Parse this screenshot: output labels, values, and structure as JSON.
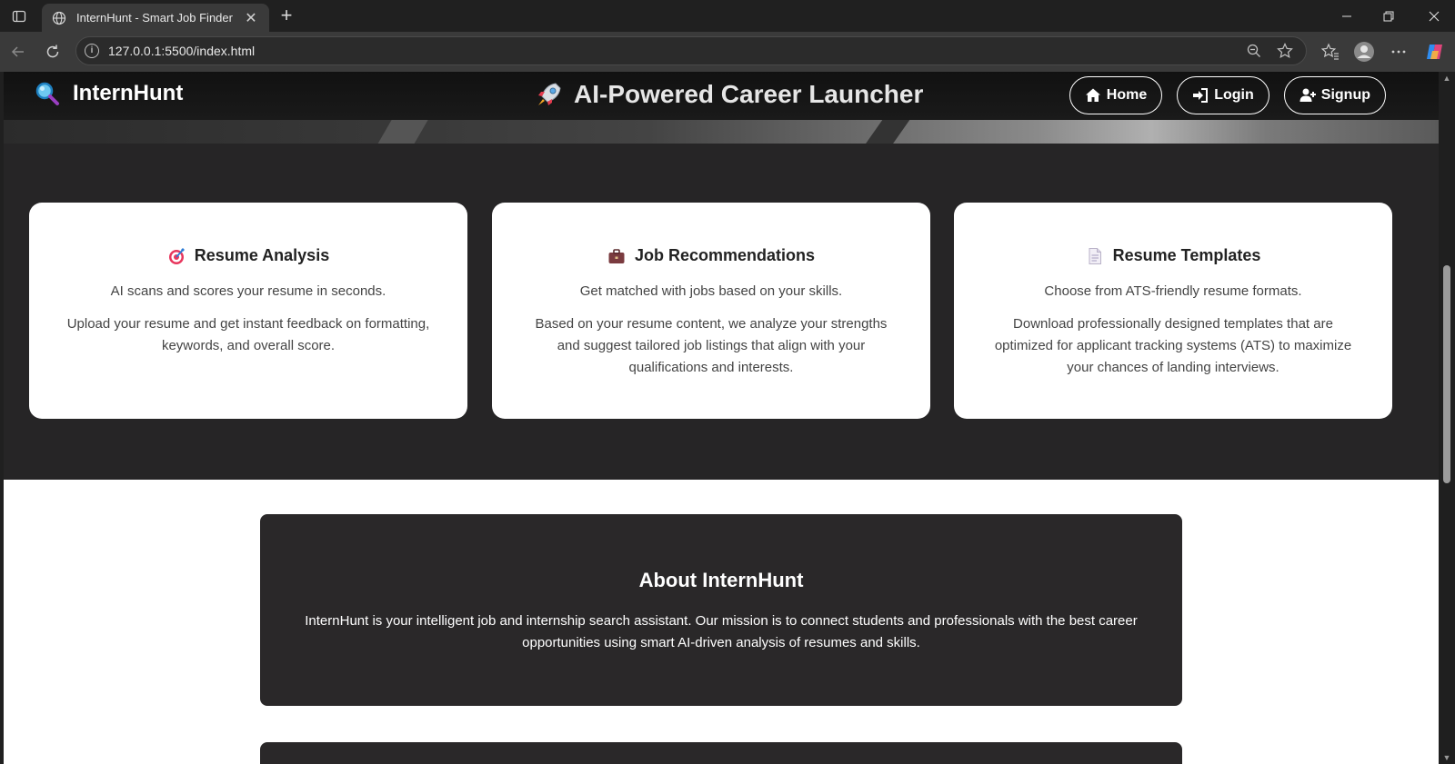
{
  "browser": {
    "tab_title": "InternHunt - Smart Job Finder",
    "url": "127.0.0.1:5500/index.html",
    "new_tab_symbol": "+",
    "close_symbol": "✕"
  },
  "navbar": {
    "brand": "InternHunt",
    "tagline": "AI-Powered Career Launcher",
    "links": {
      "home": "Home",
      "login": "Login",
      "signup": "Signup"
    }
  },
  "features": {
    "cards": [
      {
        "icon": "target-icon",
        "title": "Resume Analysis",
        "subtitle": "AI scans and scores your resume in seconds.",
        "description": "Upload your resume and get instant feedback on formatting, keywords, and overall score."
      },
      {
        "icon": "briefcase-icon",
        "title": "Job Recommendations",
        "subtitle": "Get matched with jobs based on your skills.",
        "description": "Based on your resume content, we analyze your strengths and suggest tailored job listings that align with your qualifications and interests."
      },
      {
        "icon": "document-icon",
        "title": "Resume Templates",
        "subtitle": "Choose from ATS-friendly resume formats.",
        "description": "Download professionally designed templates that are optimized for applicant tracking systems (ATS) to maximize your chances of landing interviews."
      }
    ]
  },
  "about": {
    "title": "About InternHunt",
    "text": "InternHunt is your intelligent job and internship search assistant. Our mission is to connect students and professionals with the best career opportunities using smart AI-driven analysis of resumes and skills."
  },
  "colors": {
    "page_dark": "#262526",
    "card_dark": "#2a2829",
    "chrome_dark": "#202020",
    "toolbar": "#3a3a3a"
  }
}
